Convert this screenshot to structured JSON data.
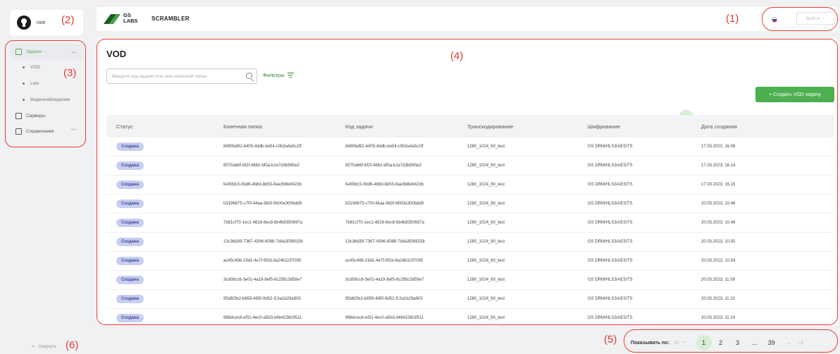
{
  "user": {
    "name": "root"
  },
  "annotations": {
    "a1": "(1)",
    "a2": "(2)",
    "a3": "(3)",
    "a4": "(4)",
    "a5": "(5)",
    "a6": "(6)"
  },
  "sidebar": {
    "items": [
      {
        "label": "Задачи",
        "active": true
      },
      {
        "label": "VOD"
      },
      {
        "label": "Live"
      },
      {
        "label": "Видеонаблюдение"
      },
      {
        "label": "Серверы"
      },
      {
        "label": "Справочники"
      }
    ],
    "collapse_label": "Свернуть"
  },
  "topbar": {
    "logo_line1": "GS",
    "logo_line2": "LABS",
    "app_name": "SCRAMBLER",
    "logout_label": "Выйти →",
    "lang_icon": "ru-flag-icon"
  },
  "main": {
    "title": "VOD",
    "search_placeholder": "Введите код задачи или имя конечной папки",
    "filters_label": "Фильтры",
    "create_label": "+ Создать VOD задачу"
  },
  "pagination": {
    "show_label": "Показывать по:",
    "page_size": "10",
    "pages": [
      "1",
      "2",
      "3",
      "...",
      "39"
    ],
    "current_page": "1",
    "next": "→",
    "last": "→|"
  },
  "table": {
    "headers": [
      "Статус",
      "Конечная папка",
      "Код задачи",
      "Транскодирование",
      "Шифрование",
      "Дата создания"
    ],
    "rows": [
      [
        "Создана",
        "8480bd92-b405-4ddb-be54-c0b3a4a5c1ff",
        "8480bd92-b405-4ddb-be54-c0b3a4a5c1ff",
        "1280_1024_60_test",
        "GS DRM/HLS3/AES/TS",
        "17.03.2023, 16.08"
      ],
      [
        "Создана",
        "8570a66f-6f2f-4662-bf0a-b1e7d3b990e2",
        "8570a66f-6f2f-4662-bf0a-b1e7d3b990e2",
        "1280_1024_60_test",
        "GS DRM/HLS3/AES/TS",
        "17.03.2023, 16.14"
      ],
      [
        "Создана",
        "fe45fdc3-0bd9-4b8d-bb53-8ae3b8e9423b",
        "fe45fdc3-0bd9-4b8d-bb53-8ae3b8e9423b",
        "1280_1024_60_test",
        "GS DRM/HLS3/AES/TS",
        "17.03.2023, 16.15"
      ],
      [
        "Создана",
        "b3196675-c70f-44aa-9b3f-9600e300bdd9",
        "b3196675-c70f-44aa-9b3f-9600e300bdd9",
        "1280_1024_60_test",
        "GS DRM/HLS3/AES/TS",
        "20.03.2023, 10.48"
      ],
      [
        "Создана",
        "7b81cf70-1ec1-4828-8ec8-6b4b8350697a",
        "7b81cf70-1ec1-4828-8ec8-6b4b8350697a",
        "1280_1024_60_test",
        "GS DRM/HLS3/AES/TS",
        "20.03.2023, 10.49"
      ],
      [
        "Создана",
        "13c36d39-7367-4396-8088-7d4a3f268158",
        "13c36d39-7367-4396-8088-7d4a3f268158",
        "1280_1024_60_test",
        "GS DRM/HLS3/AES/TS",
        "20.03.2023, 10.50"
      ],
      [
        "Создана",
        "ac45c49b-19d1-4e7f-9f2d-8a24b1197095",
        "ac45c49b-19d1-4e7f-9f2d-8a24b1197095",
        "1280_1024_60_test",
        "GS DRM/HLS3/AES/TS",
        "20.03.2023, 10.54"
      ],
      [
        "Создана",
        "3cd09cc6-3e01-4a19-8ef5-8c295c3d59e7",
        "3cd09cc6-3e01-4a19-8ef5-8c295c3d59e7",
        "1280_1024_60_test",
        "GS DRM/HLS3/AES/TS",
        "20.03.2023, 11.09"
      ],
      [
        "Создана",
        "95d82fe2-b859-485f-9d52-f13a1b29a903",
        "95d82fe2-b859-485f-9d52-f13a1b29a903",
        "1280_1024_60_test",
        "GS DRM/HLS3/AES/TS",
        "20.03.2023, 11.10"
      ],
      [
        "Создана",
        "966dcec8-ef31-4ec0-a5b3-d4b4238c9511",
        "966dcec8-ef31-4ec0-a5b3-d4b4238c9511",
        "1280_1024_60_test",
        "GS DRM/HLS3/AES/TS",
        "20.03.2023, 11.19"
      ]
    ]
  },
  "colors": {
    "accent": "#4caf50",
    "annotation": "#e33b2e",
    "badge_bg": "#c9cef0"
  }
}
